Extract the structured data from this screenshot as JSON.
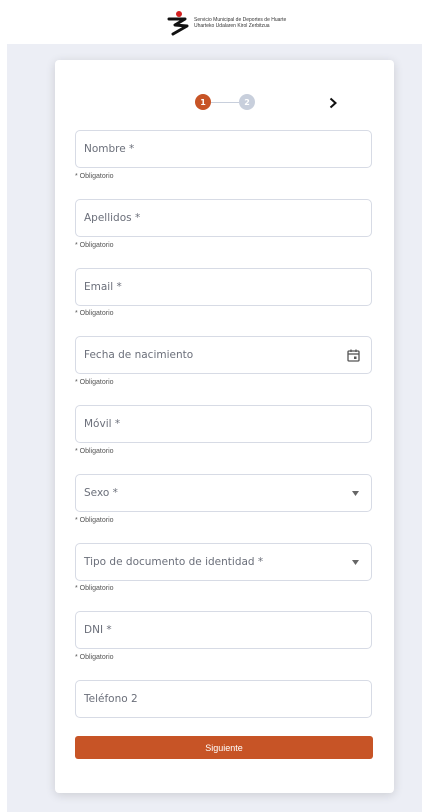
{
  "header": {
    "logo_line1": "Servicio Municipal de Deportes de Huarte",
    "logo_line2": "Uharteko Udalaren Kirol Zerbitzua",
    "logo_icon": "huarte-logo-icon"
  },
  "stepper": {
    "step1": "1",
    "step2": "2",
    "next_icon": "chevron-right-icon"
  },
  "form": {
    "nombre": {
      "label": "Nombre *",
      "hint": "* Obligatorio"
    },
    "apellidos": {
      "label": "Apellidos *",
      "hint": "* Obligatorio"
    },
    "email": {
      "label": "Email *",
      "hint": "* Obligatorio"
    },
    "fecha": {
      "label": "Fecha de nacimiento",
      "hint": "* Obligatorio",
      "icon": "calendar-icon"
    },
    "movil": {
      "label": "Móvil *",
      "hint": "* Obligatorio"
    },
    "sexo": {
      "label": "Sexo *",
      "hint": "* Obligatorio",
      "icon": "caret-down-icon"
    },
    "tipo_doc": {
      "label": "Tipo de documento de identidad *",
      "hint": "* Obligatorio",
      "icon": "caret-down-icon"
    },
    "dni": {
      "label": "DNI *",
      "hint": "* Obligatorio"
    },
    "telefono2": {
      "label": "Teléfono 2"
    }
  },
  "actions": {
    "next_label": "Siguiente"
  },
  "colors": {
    "accent": "#c75426",
    "inactive": "#c8cfdc",
    "background": "#eceef5"
  }
}
